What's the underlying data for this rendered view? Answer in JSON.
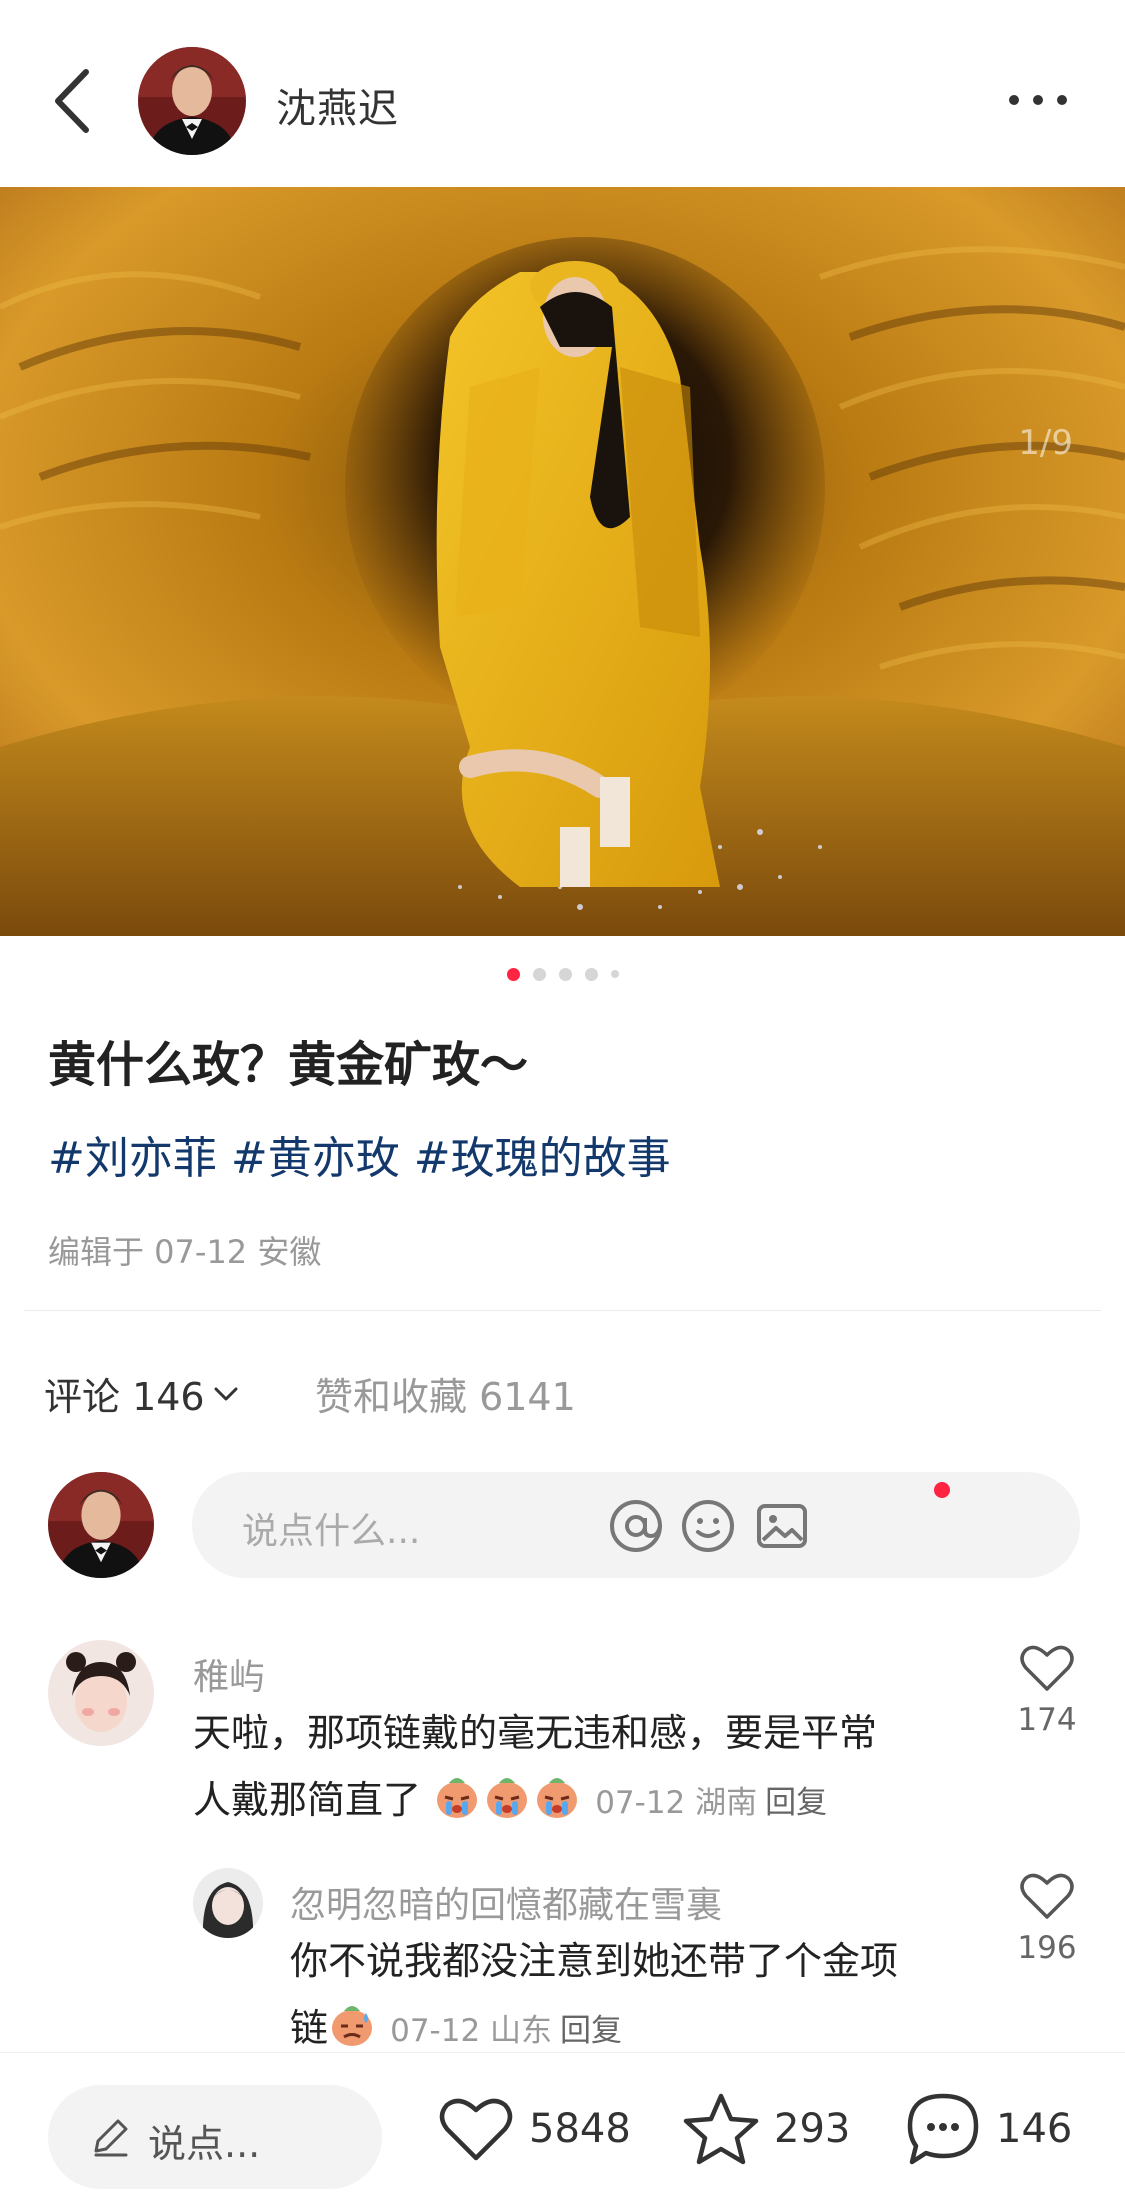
{
  "header": {
    "author_name": "沈燕迟",
    "back_icon": "chevron-left-icon",
    "more_icon": "more-horizontal-icon"
  },
  "carousel": {
    "page_counter": "1/9",
    "total_pages": 9,
    "current_page": 1,
    "active_color": "#ff2442"
  },
  "post": {
    "title": "黄什么玫？黄金矿玫～",
    "tags": [
      "#刘亦菲",
      "#黄亦玫",
      "#玫瑰的故事"
    ],
    "meta": "编辑于 07-12 安徽",
    "tag_color": "#13386c"
  },
  "stats": {
    "comments_label": "评论 146",
    "likes_saves_label": "赞和收藏 6141"
  },
  "comment_input": {
    "placeholder": "说点什么..."
  },
  "comments": [
    {
      "user": "稚屿",
      "text_line1": "天啦，那项链戴的毫无违和感，要是平常",
      "text_line2": "人戴那简直了",
      "emoji": "crying-face-icon",
      "time_location": "07-12 湖南",
      "reply_label": "回复",
      "likes": "174"
    },
    {
      "user": "忽明忽暗的回憶都藏在雪裏",
      "text_line1": "你不说我都没注意到她还带了个金项",
      "text_line2": "链",
      "emoji": "sweating-face-icon",
      "time_location": "07-12 山东",
      "reply_label": "回复",
      "likes": "196"
    }
  ],
  "bottom_bar": {
    "say_label": "说点...",
    "like_count": "5848",
    "collect_count": "293",
    "comment_count": "146"
  }
}
